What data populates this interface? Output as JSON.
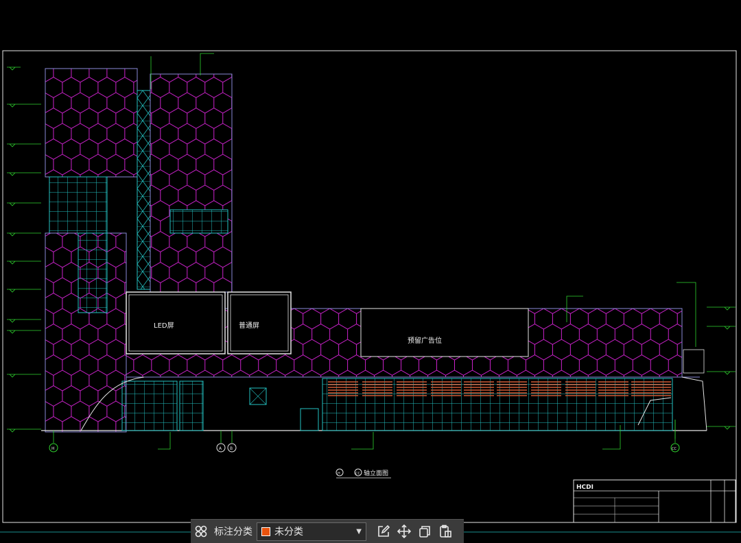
{
  "drawing": {
    "labels": {
      "led_screen": "LED屏",
      "normal_screen": "普通屏",
      "billboard": "预留广告位",
      "view_title": "轴立面图",
      "axis_start": "H",
      "axis_end": "CC",
      "axis_a": "A",
      "axis_b": "B",
      "logo": "HCDI"
    }
  },
  "toolbar": {
    "label": "标注分类",
    "category": {
      "value": "未分类",
      "color": "#e8530e"
    },
    "icons": [
      "grid-icon",
      "edit-icon",
      "move-icon",
      "copy-icon",
      "paste-icon"
    ]
  }
}
